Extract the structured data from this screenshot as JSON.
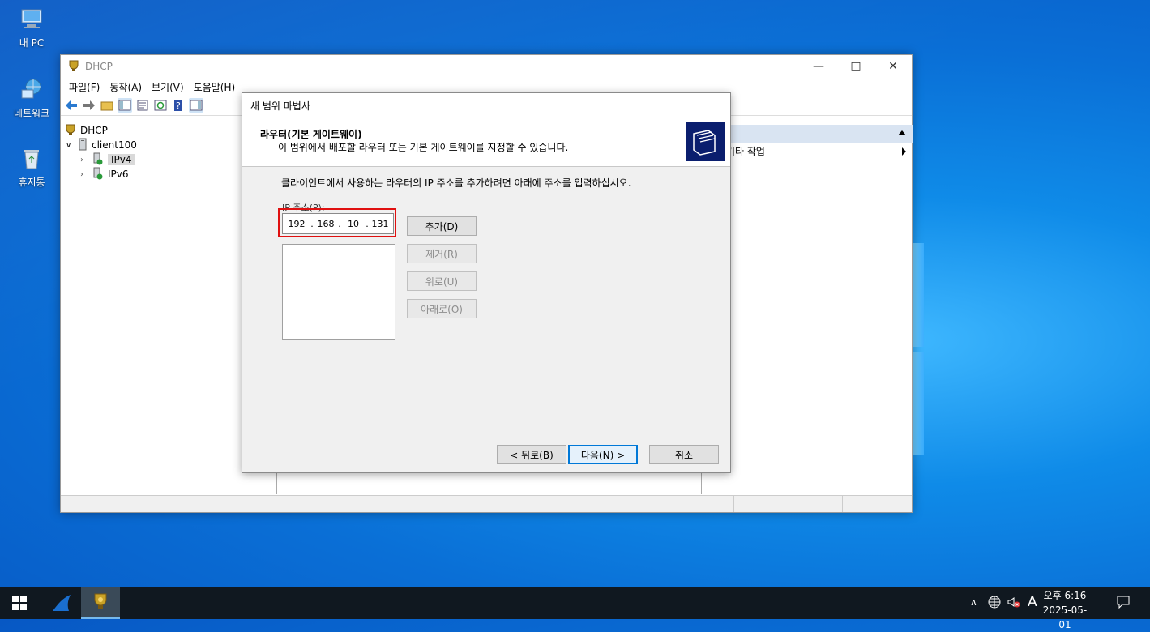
{
  "desktop": {
    "icons": [
      {
        "label": "내 PC"
      },
      {
        "label": "네트워크"
      },
      {
        "label": "휴지통"
      }
    ]
  },
  "mmc": {
    "title": "DHCP",
    "menu": [
      "파일(F)",
      "동작(A)",
      "보기(V)",
      "도움말(H)"
    ],
    "tree": {
      "root": "DHCP",
      "server": "client100",
      "ipv4": "IPv4",
      "ipv6": "IPv6"
    },
    "actions": {
      "more": "기타 작업"
    }
  },
  "wizard": {
    "title": "새 범위 마법사",
    "heading": "라우터(기본 게이트웨이)",
    "subheading": "이 범위에서 배포할 라우터 또는 기본 게이트웨이를 지정할 수 있습니다.",
    "description": "클라이언트에서 사용하는 라우터의 IP 주소를 추가하려면 아래에 주소를 입력하십시오.",
    "ip_label": "IP 주소(P):",
    "ip_octets": [
      "192",
      "168",
      "10",
      "131"
    ],
    "buttons": {
      "add": "추가(D)",
      "remove": "제거(R)",
      "up": "위로(U)",
      "down": "아래로(O)",
      "back": "< 뒤로(B)",
      "next": "다음(N) >",
      "cancel": "취소"
    }
  },
  "taskbar": {
    "time": "오후 6:16",
    "date": "2025-05-01",
    "ime": "A"
  },
  "colors": {
    "highlight_box": "#e01010",
    "default_button_border": "#0078d7"
  }
}
